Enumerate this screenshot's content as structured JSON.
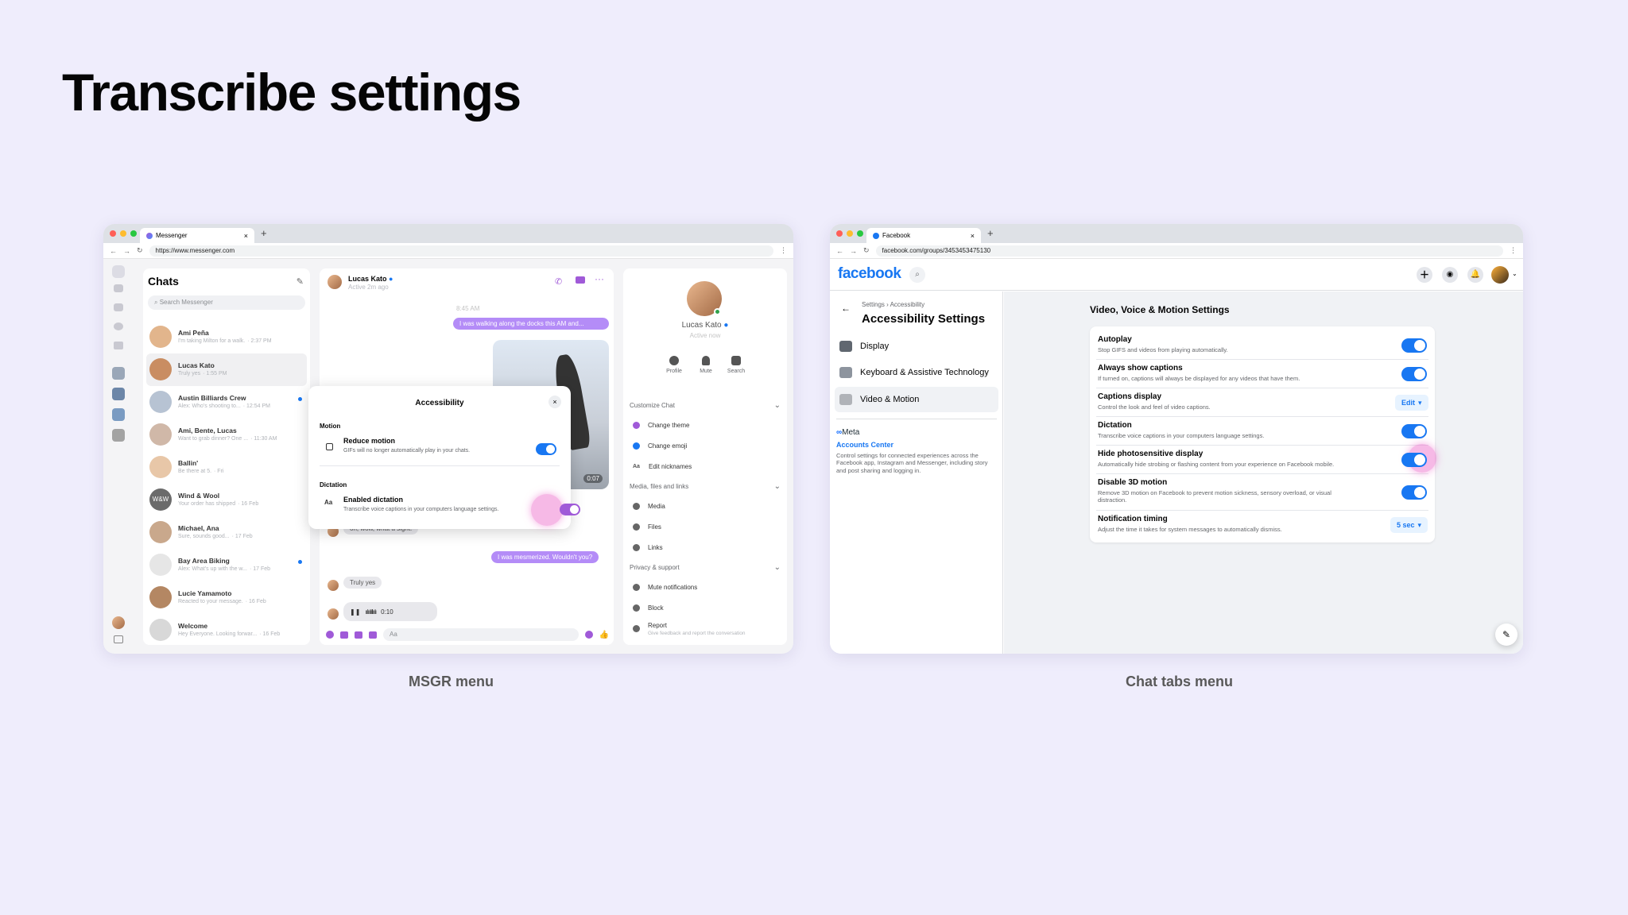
{
  "page": {
    "title": "Transcribe settings",
    "left_caption": "MSGR menu",
    "right_caption": "Chat tabs menu"
  },
  "msgr": {
    "tab_title": "Messenger",
    "url": "https://www.messenger.com",
    "chats_title": "Chats",
    "search_placeholder": "Search Messenger",
    "chats": [
      {
        "name": "Ami Peña",
        "preview": "I'm taking Milton for a walk.",
        "time": "· 2:37 PM"
      },
      {
        "name": "Lucas Kato",
        "preview": "Truly yes",
        "time": "· 1:55 PM"
      },
      {
        "name": "Austin Billiards Crew",
        "preview": "Alex: Who's shooting to...",
        "time": "· 12:54 PM"
      },
      {
        "name": "Ami, Bente, Lucas",
        "preview": "Want to grab dinner? One ...",
        "time": "· 11:30 AM"
      },
      {
        "name": "Ballin'",
        "preview": "Be there at 5.",
        "time": "· Fri"
      },
      {
        "name": "Wind & Wool",
        "preview": "Your order has shipped",
        "time": "· 16 Feb"
      },
      {
        "name": "Michael, Ana",
        "preview": "Sure, sounds good...",
        "time": "· 17 Feb"
      },
      {
        "name": "Bay Area Biking",
        "preview": "Alex: What's up with the w...",
        "time": "· 17 Feb"
      },
      {
        "name": "Lucie Yamamoto",
        "preview": "Reacted to your message.",
        "time": "· 16 Feb"
      },
      {
        "name": "Welcome",
        "preview": "Hey Everyone. Looking forwar...",
        "time": "· 16 Feb"
      }
    ],
    "wind_wool_initials": "W&W",
    "conversation": {
      "name": "Lucas Kato",
      "status": "Active 2m ago",
      "time_divider": "8:45 AM",
      "msg1": "I was walking along the docks this AM and...",
      "video_duration": "0:07",
      "msg2": "oh, wow, what a sight!",
      "msg3": "I was mesmerized. Wouldn't you?",
      "msg4": "Truly yes",
      "voice_duration": "0:10",
      "composer_placeholder": "Aa"
    },
    "modal": {
      "title": "Accessibility",
      "motion_header": "Motion",
      "reduce_motion_title": "Reduce motion",
      "reduce_motion_desc": "GIFs will no longer automatically play in your chats.",
      "dictation_header": "Dictation",
      "dictation_title": "Enabled dictation",
      "dictation_desc": "Transcribe voice captions in your computers language settings.",
      "dictation_icon_label": "Aa"
    },
    "profile": {
      "name": "Lucas Kato",
      "status": "Active now",
      "actions": [
        "Profile",
        "Mute",
        "Search"
      ],
      "customize_header": "Customize Chat",
      "customize_items": [
        "Change theme",
        "Change emoji",
        "Edit nicknames"
      ],
      "media_header": "Media, files and links",
      "media_items": [
        "Media",
        "Files",
        "Links"
      ],
      "privacy_header": "Privacy & support",
      "privacy_items": [
        "Mute notifications",
        "Block",
        "Report"
      ],
      "report_desc": "Give feedback and report the conversation",
      "edit_nick_icon": "Aa"
    }
  },
  "fb": {
    "tab_title": "Facebook",
    "url": "facebook.com/groups/3453453475130",
    "logo": "facebook",
    "breadcrumb": "Settings › Accessibility",
    "settings_title": "Accessibility Settings",
    "nav": [
      "Display",
      "Keyboard & Assistive Technology",
      "Video & Motion"
    ],
    "meta_label": "Meta",
    "accounts_center": "Accounts Center",
    "accounts_desc": "Control settings for connected experiences across the Facebook app, Instagram and Messenger, including story and post sharing and logging in.",
    "section_title": "Video, Voice & Motion Settings",
    "settings": [
      {
        "title": "Autoplay",
        "desc": "Stop GIFS and videos from playing automatically."
      },
      {
        "title": "Always show captions",
        "desc": "If turned on, captions will always be displayed for any videos that have them."
      },
      {
        "title": "Captions display",
        "desc": "Control the look and feel of video captions.",
        "control": "Edit"
      },
      {
        "title": "Dictation",
        "desc": "Transcribe voice captions in your computers language settings."
      },
      {
        "title": "Hide photosensitive display",
        "desc": "Automatically hide strobing or flashing content from your experience on Facebook mobile."
      },
      {
        "title": "Disable 3D motion",
        "desc": "Remove 3D motion on Facebook to prevent motion sickness, sensory overload, or visual distraction."
      },
      {
        "title": "Notification timing",
        "desc": "Adjust the time it takes for system messages to automatically dismiss.",
        "control": "5 sec"
      }
    ]
  },
  "colors": {
    "fb_blue": "#1877f2",
    "msgr_purple": "#a05ad8",
    "bubble": "#b48cf7",
    "background": "#efedfc"
  }
}
